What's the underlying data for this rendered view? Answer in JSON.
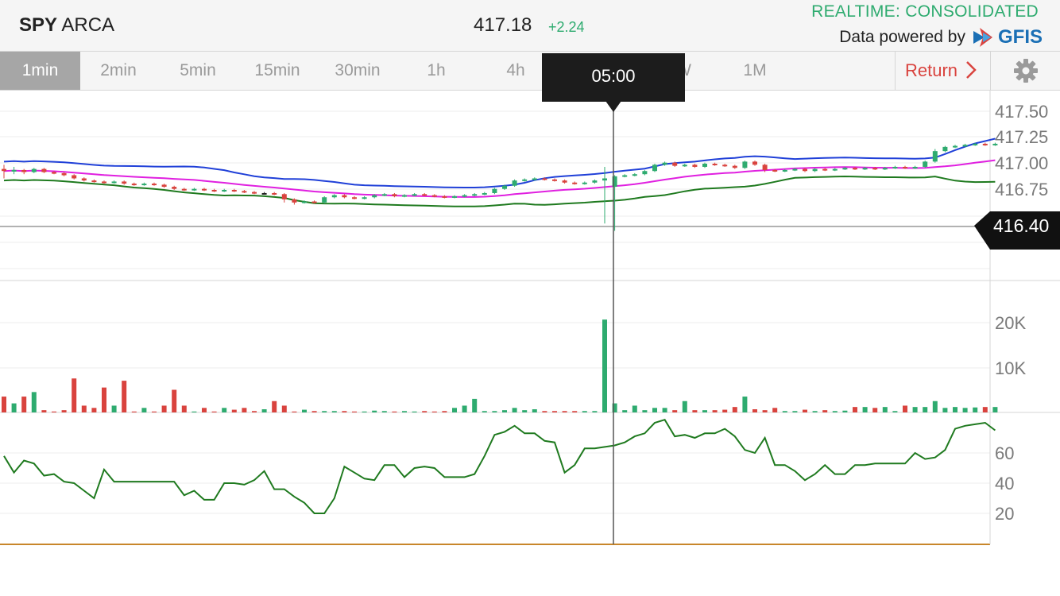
{
  "header": {
    "symbol": "SPY",
    "exchange": "ARCA",
    "price": "417.18",
    "change": "+2.24",
    "realtime": "REALTIME: CONSOLIDATED",
    "powered_by": "Data powered by",
    "logo": "GFIS"
  },
  "tabs": [
    {
      "label": "1min",
      "active": true
    },
    {
      "label": "2min",
      "active": false
    },
    {
      "label": "5min",
      "active": false
    },
    {
      "label": "15min",
      "active": false
    },
    {
      "label": "30min",
      "active": false
    },
    {
      "label": "1h",
      "active": false
    },
    {
      "label": "4h",
      "active": false
    },
    {
      "label": "W",
      "active": false
    },
    {
      "label": "1M",
      "active": false
    }
  ],
  "return_label": "Return",
  "tooltip": "05:00",
  "colors": {
    "up": "#2eab6f",
    "down": "#d9433e",
    "bb_upper": "#2040d8",
    "bb_mid": "#e020e0",
    "bb_lower": "#1f7a1f",
    "rsi": "#1f7a1f",
    "crosshair": "#555555"
  },
  "chart_data": {
    "type": "candlestick",
    "price_axis": {
      "ticks": [
        "417.50",
        "417.25",
        "417.00",
        "416.75"
      ],
      "ylim": [
        416.0,
        417.6
      ]
    },
    "crosshair_price": "416.40",
    "volume_axis": {
      "ticks": [
        "20K",
        "10K"
      ],
      "ylim": [
        0,
        28000
      ]
    },
    "rsi_axis": {
      "ticks": [
        "60",
        "40",
        "20"
      ],
      "ylim": [
        0,
        100
      ]
    },
    "candles": [
      [
        416.95,
        416.93,
        416.99,
        416.86
      ],
      [
        416.93,
        416.94,
        416.97,
        416.9
      ],
      [
        416.94,
        416.92,
        416.95,
        416.9
      ],
      [
        416.92,
        416.95,
        416.96,
        416.91
      ],
      [
        416.95,
        416.92,
        416.96,
        416.91
      ],
      [
        416.92,
        416.91,
        416.93,
        416.9
      ],
      [
        416.91,
        416.89,
        416.92,
        416.88
      ],
      [
        416.89,
        416.86,
        416.9,
        416.85
      ],
      [
        416.86,
        416.84,
        416.87,
        416.83
      ],
      [
        416.84,
        416.83,
        416.85,
        416.82
      ],
      [
        416.83,
        416.82,
        416.84,
        416.81
      ],
      [
        416.82,
        416.83,
        416.84,
        416.81
      ],
      [
        416.83,
        416.81,
        416.84,
        416.8
      ],
      [
        416.81,
        416.8,
        416.82,
        416.79
      ],
      [
        416.8,
        416.81,
        416.82,
        416.79
      ],
      [
        416.81,
        416.8,
        416.82,
        416.79
      ],
      [
        416.8,
        416.78,
        416.81,
        416.77
      ],
      [
        416.78,
        416.76,
        416.79,
        416.75
      ],
      [
        416.76,
        416.75,
        416.77,
        416.74
      ],
      [
        416.75,
        416.76,
        416.77,
        416.74
      ],
      [
        416.76,
        416.75,
        416.77,
        416.74
      ],
      [
        416.75,
        416.74,
        416.76,
        416.73
      ],
      [
        416.74,
        416.75,
        416.76,
        416.73
      ],
      [
        416.75,
        416.74,
        416.76,
        416.73
      ],
      [
        416.74,
        416.73,
        416.75,
        416.72
      ],
      [
        416.73,
        416.72,
        416.74,
        416.71
      ],
      [
        416.72,
        416.72,
        416.73,
        416.71
      ],
      [
        416.72,
        416.71,
        416.73,
        416.7
      ],
      [
        416.71,
        416.66,
        416.72,
        416.63
      ],
      [
        416.66,
        416.63,
        416.67,
        416.61
      ],
      [
        416.63,
        416.64,
        416.65,
        416.62
      ],
      [
        416.64,
        416.63,
        416.65,
        416.62
      ],
      [
        416.63,
        416.68,
        416.69,
        416.62
      ],
      [
        416.68,
        416.7,
        416.71,
        416.67
      ],
      [
        416.7,
        416.68,
        416.71,
        416.67
      ],
      [
        416.68,
        416.67,
        416.69,
        416.66
      ],
      [
        416.67,
        416.68,
        416.69,
        416.66
      ],
      [
        416.68,
        416.7,
        416.71,
        416.67
      ],
      [
        416.7,
        416.71,
        416.72,
        416.69
      ],
      [
        416.71,
        416.69,
        416.72,
        416.68
      ],
      [
        416.69,
        416.7,
        416.71,
        416.68
      ],
      [
        416.7,
        416.71,
        416.72,
        416.69
      ],
      [
        416.71,
        416.7,
        416.72,
        416.69
      ],
      [
        416.7,
        416.69,
        416.71,
        416.68
      ],
      [
        416.69,
        416.68,
        416.7,
        416.67
      ],
      [
        416.68,
        416.69,
        416.7,
        416.67
      ],
      [
        416.69,
        416.7,
        416.71,
        416.68
      ],
      [
        416.7,
        416.71,
        416.72,
        416.69
      ],
      [
        416.71,
        416.72,
        416.73,
        416.7
      ],
      [
        416.72,
        416.76,
        416.77,
        416.71
      ],
      [
        416.76,
        416.79,
        416.8,
        416.75
      ],
      [
        416.79,
        416.84,
        416.85,
        416.78
      ],
      [
        416.84,
        416.85,
        416.86,
        416.83
      ],
      [
        416.85,
        416.86,
        416.87,
        416.84
      ],
      [
        416.86,
        416.85,
        416.87,
        416.84
      ],
      [
        416.85,
        416.84,
        416.86,
        416.83
      ],
      [
        416.84,
        416.82,
        416.85,
        416.81
      ],
      [
        416.82,
        416.81,
        416.83,
        416.8
      ],
      [
        416.81,
        416.82,
        416.83,
        416.8
      ],
      [
        416.82,
        416.84,
        416.85,
        416.81
      ],
      [
        416.84,
        416.86,
        416.97,
        416.43
      ],
      [
        416.78,
        416.88,
        416.89,
        416.36
      ],
      [
        416.88,
        416.89,
        416.9,
        416.87
      ],
      [
        416.89,
        416.9,
        416.91,
        416.88
      ],
      [
        416.9,
        416.93,
        416.94,
        416.89
      ],
      [
        416.93,
        416.99,
        417.0,
        416.92
      ],
      [
        416.99,
        417.01,
        417.02,
        416.98
      ],
      [
        417.01,
        416.98,
        417.02,
        416.97
      ],
      [
        416.98,
        416.99,
        417.0,
        416.97
      ],
      [
        416.99,
        416.97,
        417.0,
        416.96
      ],
      [
        416.97,
        417.0,
        417.01,
        416.96
      ],
      [
        417.0,
        416.99,
        417.01,
        416.98
      ],
      [
        416.99,
        416.98,
        417.0,
        416.97
      ],
      [
        416.98,
        416.96,
        416.99,
        416.95
      ],
      [
        416.96,
        417.02,
        417.03,
        416.95
      ],
      [
        417.02,
        416.99,
        417.03,
        416.98
      ],
      [
        416.99,
        416.94,
        417.0,
        416.92
      ],
      [
        416.94,
        416.93,
        416.95,
        416.92
      ],
      [
        416.93,
        416.94,
        416.95,
        416.92
      ],
      [
        416.94,
        416.95,
        416.96,
        416.93
      ],
      [
        416.95,
        416.93,
        416.96,
        416.92
      ],
      [
        416.93,
        416.95,
        416.96,
        416.92
      ],
      [
        416.95,
        416.94,
        416.96,
        416.93
      ],
      [
        416.94,
        416.95,
        416.96,
        416.93
      ],
      [
        416.95,
        416.96,
        416.97,
        416.94
      ],
      [
        416.96,
        416.95,
        416.97,
        416.94
      ],
      [
        416.95,
        416.96,
        416.97,
        416.94
      ],
      [
        416.96,
        416.95,
        416.97,
        416.94
      ],
      [
        416.95,
        416.96,
        416.97,
        416.94
      ],
      [
        416.96,
        416.97,
        416.98,
        416.95
      ],
      [
        416.97,
        416.96,
        416.98,
        416.95
      ],
      [
        416.96,
        416.97,
        416.98,
        416.95
      ],
      [
        416.97,
        417.02,
        417.03,
        416.96
      ],
      [
        417.02,
        417.12,
        417.14,
        417.01
      ],
      [
        417.12,
        417.16,
        417.17,
        417.11
      ],
      [
        417.16,
        417.17,
        417.18,
        417.15
      ],
      [
        417.17,
        417.18,
        417.19,
        417.16
      ],
      [
        417.18,
        417.19,
        417.2,
        417.17
      ],
      [
        417.19,
        417.18,
        417.2,
        417.17
      ],
      [
        417.18,
        417.19,
        417.2,
        417.17
      ]
    ],
    "volume": [
      3500,
      2000,
      3500,
      4500,
      500,
      200,
      500,
      7500,
      1500,
      1000,
      5500,
      1500,
      7000,
      200,
      1000,
      200,
      1500,
      5000,
      1500,
      200,
      1000,
      200,
      1000,
      600,
      1000,
      300,
      700,
      2500,
      1500,
      200,
      600,
      300,
      300,
      300,
      300,
      200,
      200,
      400,
      300,
      200,
      300,
      200,
      300,
      200,
      300,
      1000,
      1500,
      3000,
      300,
      300,
      500,
      1000,
      500,
      700,
      300,
      300,
      300,
      300,
      300,
      300,
      20500,
      2000,
      500,
      1500,
      500,
      1000,
      1000,
      500,
      2500,
      500,
      500,
      500,
      600,
      1200,
      3500,
      700,
      500,
      1000,
      300,
      300,
      600,
      300,
      500,
      300,
      400,
      1200,
      1200,
      1000,
      1200,
      300,
      1500,
      1200,
      1200,
      2500,
      1000,
      1200,
      1000,
      1100,
      1200,
      1200
    ],
    "rsi": [
      58,
      47,
      55,
      53,
      45,
      46,
      41,
      40,
      35,
      30,
      49,
      41,
      41,
      41,
      41,
      41,
      41,
      41,
      32,
      35,
      29,
      29,
      40,
      40,
      39,
      42,
      48,
      36,
      36,
      31,
      27,
      20,
      20,
      30,
      51,
      47,
      43,
      42,
      52,
      52,
      44,
      50,
      51,
      50,
      44,
      44,
      44,
      46,
      58,
      72,
      74,
      78,
      73,
      73,
      68,
      67,
      47,
      52,
      63,
      63,
      64,
      65,
      67,
      71,
      73,
      80,
      82,
      71,
      72,
      70,
      73,
      73,
      76,
      71,
      62,
      60,
      70,
      52,
      52,
      48,
      42,
      46,
      52,
      46,
      46,
      52,
      52,
      53,
      53,
      53,
      53,
      60,
      56,
      57,
      62,
      76,
      78,
      79,
      80,
      75
    ]
  }
}
